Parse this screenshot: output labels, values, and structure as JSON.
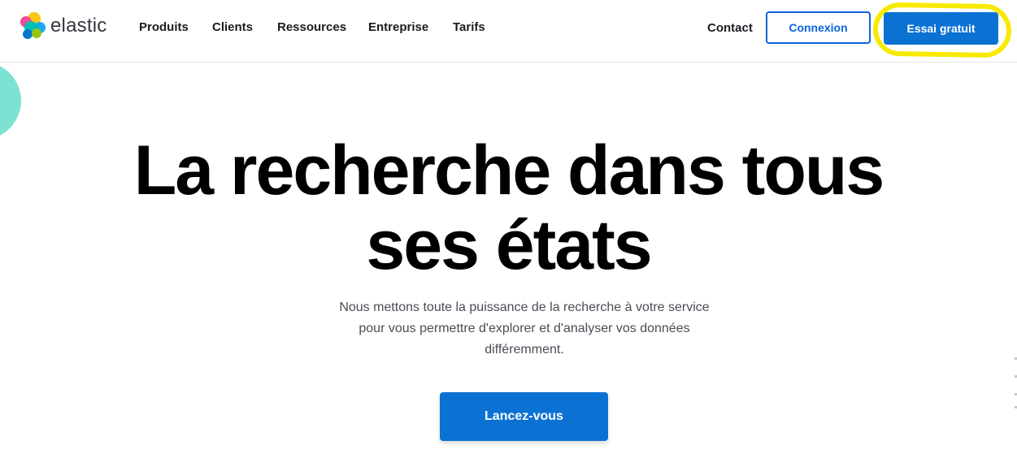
{
  "brand": {
    "name": "elastic",
    "logo_icon": "elastic-logo-icon"
  },
  "nav": {
    "items": [
      {
        "label": "Produits"
      },
      {
        "label": "Clients"
      },
      {
        "label": "Ressources"
      },
      {
        "label": "Entreprise"
      },
      {
        "label": "Tarifs"
      }
    ],
    "contact_label": "Contact",
    "login_label": "Connexion",
    "trial_label": "Essai gratuit"
  },
  "hero": {
    "title_line1": "La recherche dans tous",
    "title_line2": "ses états",
    "subtitle_line1": "Nous mettons toute la puissance de la recherche à votre service",
    "subtitle_line2": "pour vous permettre d'explorer et d'analyser vos données",
    "subtitle_line3": "différemment.",
    "cta_label": "Lancez-vous"
  },
  "colors": {
    "primary": "#0b72d3",
    "highlight": "#f7ea00",
    "accent_circle": "#7de2d1",
    "title": "#000000"
  }
}
